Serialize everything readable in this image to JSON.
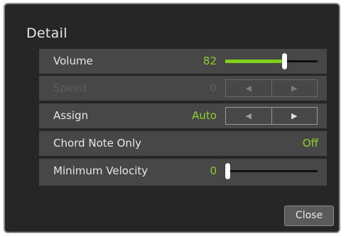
{
  "dialog": {
    "title": "Detail",
    "close_label": "Close"
  },
  "rows": [
    {
      "label": "Volume",
      "value": "82",
      "control": "slider",
      "level": 0.65
    },
    {
      "label": "Speed",
      "value": "0",
      "control": "arrows",
      "enabled": false
    },
    {
      "label": "Assign",
      "value": "Auto",
      "control": "arrows",
      "enabled": true
    },
    {
      "label": "Chord Note Only",
      "value": "Off",
      "control": "none"
    },
    {
      "label": "Minimum Velocity",
      "value": "0",
      "control": "slider",
      "level": 0.0
    }
  ],
  "arrows": {
    "left_glyph": "◀",
    "right_glyph": "▶"
  },
  "colors": {
    "accent": "#8ed12a",
    "panel": "#262626",
    "row": "#474747"
  }
}
